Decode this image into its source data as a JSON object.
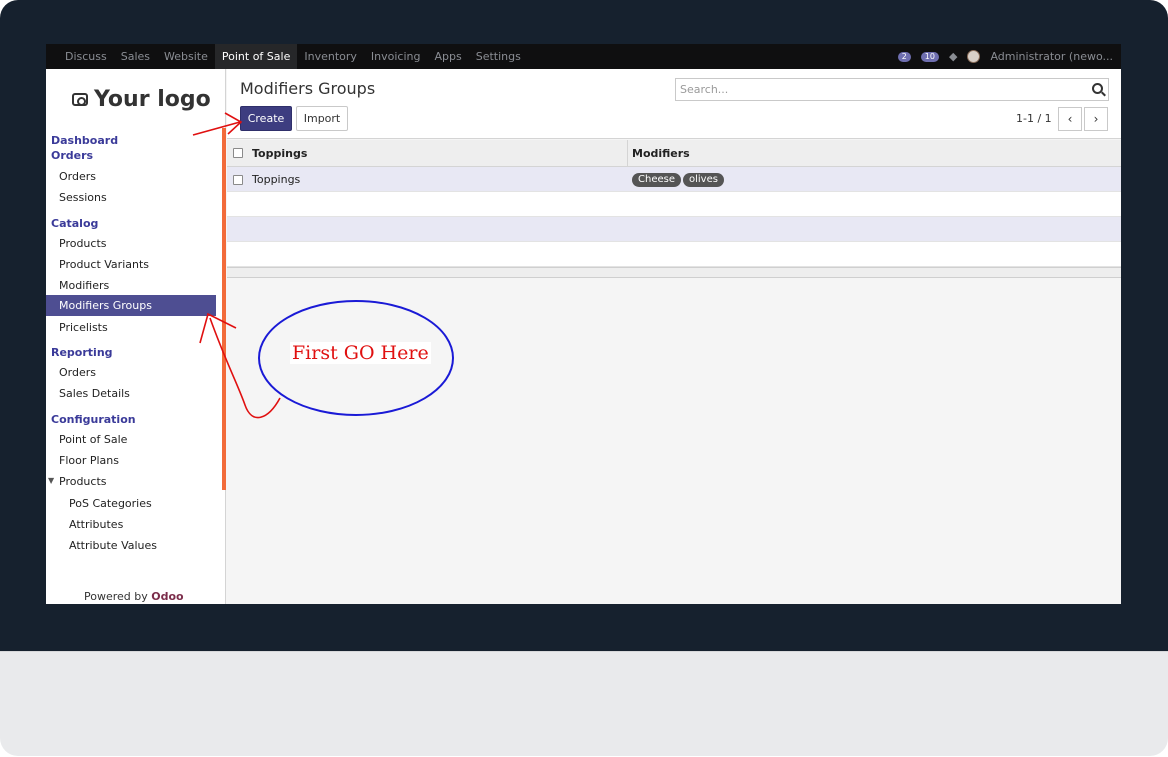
{
  "topnav": {
    "menu": [
      "Discuss",
      "Sales",
      "Website",
      "Point of Sale",
      "Inventory",
      "Invoicing",
      "Apps",
      "Settings"
    ],
    "active": "Point of Sale",
    "chat_count": "2",
    "activity_count": "10",
    "user": "Administrator (newo..."
  },
  "sidebar": {
    "logo": "Your logo",
    "sections": {
      "dashboard": "Dashboard",
      "orders": "Orders",
      "orders_items": [
        "Orders",
        "Sessions"
      ],
      "catalog": "Catalog",
      "catalog_items": [
        "Products",
        "Product Variants",
        "Modifiers",
        "Modifiers Groups",
        "Pricelists"
      ],
      "reporting": "Reporting",
      "reporting_items": [
        "Orders",
        "Sales Details"
      ],
      "configuration": "Configuration",
      "configuration_items": [
        "Point of Sale",
        "Floor Plans",
        "Products"
      ],
      "products_sub": [
        "PoS Categories",
        "Attributes",
        "Attribute Values"
      ]
    },
    "selected": "Modifiers Groups",
    "powered_by": "Powered by",
    "brand": "Odoo"
  },
  "main": {
    "title": "Modifiers Groups",
    "create": "Create",
    "import": "Import",
    "search_placeholder": "Search...",
    "pager": "1-1 / 1",
    "prev_icon": "chevron-left-icon",
    "next_icon": "chevron-right-icon"
  },
  "table": {
    "columns": [
      "Toppings",
      "Modifiers"
    ],
    "rows": [
      {
        "name": "Toppings",
        "modifiers": [
          "Cheese",
          "olives"
        ]
      }
    ]
  },
  "annotation": {
    "callout": "First  GO  Here",
    "colors": {
      "arrow": "#e01010",
      "ellipse": "#1a1ad6",
      "bar": "#f26b3a"
    }
  }
}
